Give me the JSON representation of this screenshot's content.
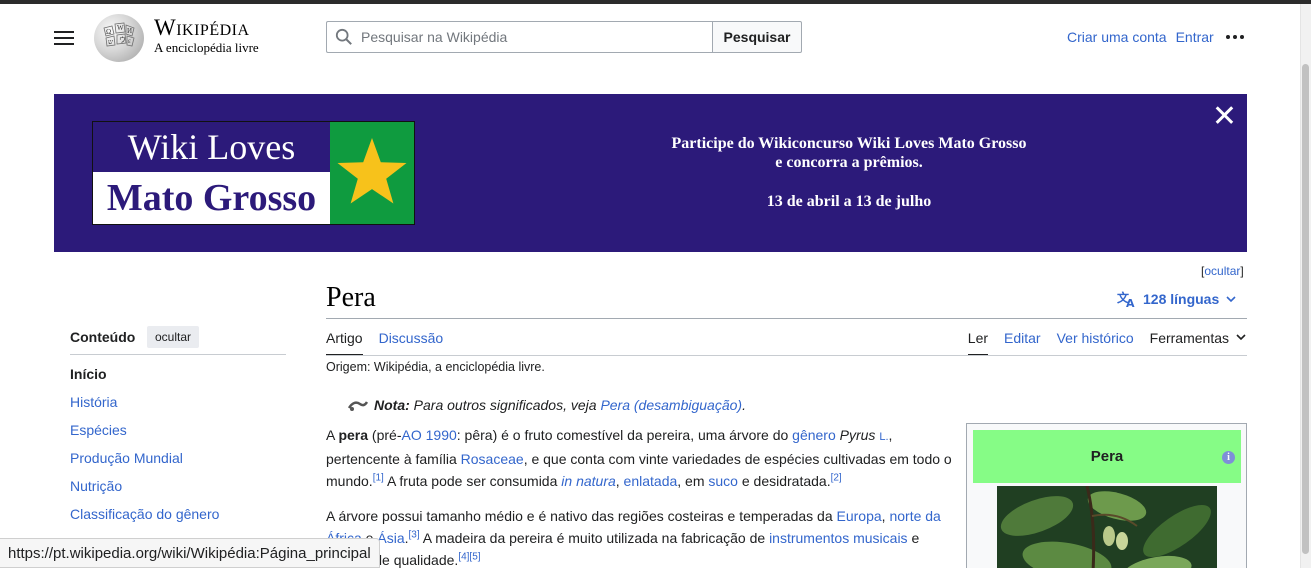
{
  "header": {
    "wordmark_title": "Wikipédia",
    "wordmark_tagline": "A enciclopédia livre",
    "search_placeholder": "Pesquisar na Wikipédia",
    "search_button": "Pesquisar",
    "create_account": "Criar uma conta",
    "login": "Entrar"
  },
  "banner": {
    "logo_line1": "Wiki Loves",
    "logo_line2": "Mato Grosso",
    "message_line1": "Participe do Wikiconcurso Wiki Loves Mato Grosso",
    "message_line2": "e concorra a prêmios.",
    "dates": "13 de abril a 13 de julho",
    "close": "✕",
    "hide_link": "ocultar"
  },
  "article": {
    "title": "Pera",
    "languages": "128 línguas",
    "tabs_left": [
      "Artigo",
      "Discussão"
    ],
    "tabs_right": [
      "Ler",
      "Editar",
      "Ver histórico"
    ],
    "tools": "Ferramentas",
    "origin": "Origem: Wikipédia, a enciclopédia livre.",
    "hatnote_label": "Nota:",
    "hatnote_text": "Para outros significados, veja",
    "hatnote_link": "Pera (desambiguação)"
  },
  "toc": {
    "title": "Conteúdo",
    "hide": "ocultar",
    "items": [
      "Início",
      "História",
      "Espécies",
      "Produção Mundial",
      "Nutrição",
      "Classificação do gênero"
    ]
  },
  "infobox": {
    "title": "Pera"
  },
  "status_bar": {
    "url": "https://pt.wikipedia.org/wiki/Wikipédia:Página_principal"
  },
  "colors": {
    "link": "#3366cc",
    "banner_bg": "#2c1a7a",
    "flag_green": "#0f9b3f",
    "star": "#f7c21b",
    "infobox_header": "#86fc86"
  }
}
